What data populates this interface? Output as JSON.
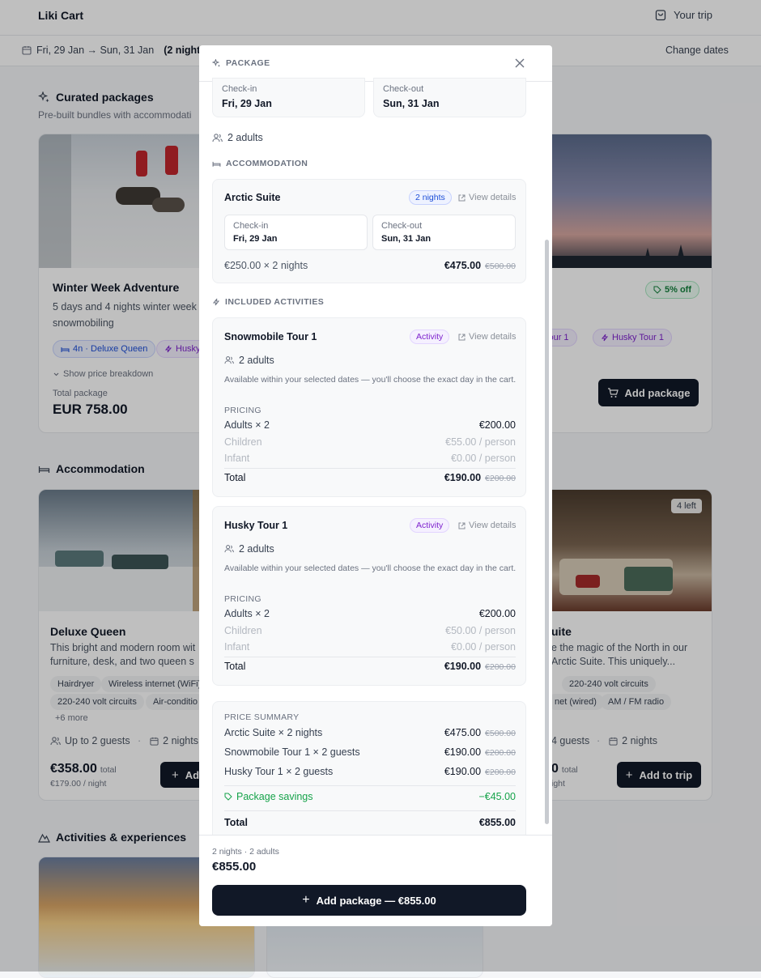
{
  "app": {
    "title": "Liki Cart",
    "your_trip": "Your trip"
  },
  "datebar": {
    "range": "Fri, 29 Jan → Sun, 31 Jan",
    "nights": "(2 nights)",
    "change": "Change dates"
  },
  "packages": {
    "title": "Curated packages",
    "subtitle": "Pre-built bundles with accommodati",
    "card1": {
      "name": "Winter Week Adventure",
      "desc1": "5 days and 4 nights winter week",
      "desc2": "snowmobiling",
      "chip_room": "4n · Deluxe Queen",
      "chip_husky": "Husky",
      "breakdown": "Show price breakdown",
      "total_label": "Total package",
      "total": "EUR 758.00"
    },
    "card2": {
      "discount": "5% off",
      "chip_tour": "e Tour 1",
      "chip_husky": "Husky Tour 1",
      "button": "Add package"
    }
  },
  "accommodation": {
    "title": "Accommodation",
    "card1": {
      "name": "Deluxe Queen",
      "desc1": "This bright and modern room wit",
      "desc2": "furniture, desk, and two queen s",
      "amenities": [
        "Hairdryer",
        "Wireless internet (WiFi)",
        "220-240 volt circuits",
        "Air-conditio"
      ],
      "more": "+6 more",
      "guests": "Up to 2 guests",
      "nights": "2 nights",
      "price": "€358.00",
      "price_suffix": "total",
      "per_night": "€179.00 / night",
      "button": "Ad"
    },
    "card2": {
      "badge": "4 left",
      "name": "uite",
      "desc1": "e the magic of the North in our",
      "desc2": "Arctic Suite. This uniquely...",
      "amenities": [
        "220-240 volt circuits",
        "net (wired)",
        "AM / FM radio"
      ],
      "guests": "4 guests",
      "nights": "2 nights",
      "price": "0",
      "price_suffix": "total",
      "per_night": "ight",
      "button": "Add to trip"
    }
  },
  "activities": {
    "title": "Activities & experiences"
  },
  "modal": {
    "header": "PACKAGE",
    "checkin_label": "Check-in",
    "checkin": "Fri, 29 Jan",
    "checkout_label": "Check-out",
    "checkout": "Sun, 31 Jan",
    "guests": "2 adults",
    "accommodation_header": "ACCOMMODATION",
    "acc": {
      "name": "Arctic Suite",
      "badge": "2 nights",
      "details": "View details",
      "checkin_label": "Check-in",
      "checkin": "Fri, 29 Jan",
      "checkout_label": "Check-out",
      "checkout": "Sun, 31 Jan",
      "calc": "€250.00 × 2 nights",
      "price": "€475.00",
      "old_price": "€500.00"
    },
    "activities_header": "INCLUDED ACTIVITIES",
    "act1": {
      "name": "Snowmobile Tour 1",
      "badge": "Activity",
      "details": "View details",
      "guests": "2 adults",
      "note": "Available within your selected dates — you'll choose the exact day in the cart.",
      "pricing": "PRICING",
      "adults_label": "Adults × 2",
      "adults_price": "€200.00",
      "children_label": "Children",
      "children_price": "€55.00 / person",
      "infant_label": "Infant",
      "infant_price": "€0.00 / person",
      "total_label": "Total",
      "total": "€190.00",
      "old_total": "€200.00"
    },
    "act2": {
      "name": "Husky Tour 1",
      "badge": "Activity",
      "details": "View details",
      "guests": "2 adults",
      "note": "Available within your selected dates — you'll choose the exact day in the cart.",
      "pricing": "PRICING",
      "adults_label": "Adults × 2",
      "adults_price": "€200.00",
      "children_label": "Children",
      "children_price": "€50.00 / person",
      "infant_label": "Infant",
      "infant_price": "€0.00 / person",
      "total_label": "Total",
      "total": "€190.00",
      "old_total": "€200.00"
    },
    "summary": {
      "header": "PRICE SUMMARY",
      "line1_label": "Arctic Suite × 2 nights",
      "line1_price": "€475.00",
      "line1_old": "€500.00",
      "line2_label": "Snowmobile Tour 1 × 2 guests",
      "line2_price": "€190.00",
      "line2_old": "€200.00",
      "line3_label": "Husky Tour 1 × 2 guests",
      "line3_price": "€190.00",
      "line3_old": "€200.00",
      "savings_label": "Package savings",
      "savings": "−€45.00",
      "total_label": "Total",
      "total": "€855.00"
    },
    "footer": {
      "meta": "2 nights · 2 adults",
      "total": "€855.00",
      "button": "Add package — €855.00"
    }
  },
  "colors": {
    "dark": "#111827",
    "green": "#16a34a",
    "blue": "#1d4ed8",
    "purple": "#7e22ce"
  }
}
